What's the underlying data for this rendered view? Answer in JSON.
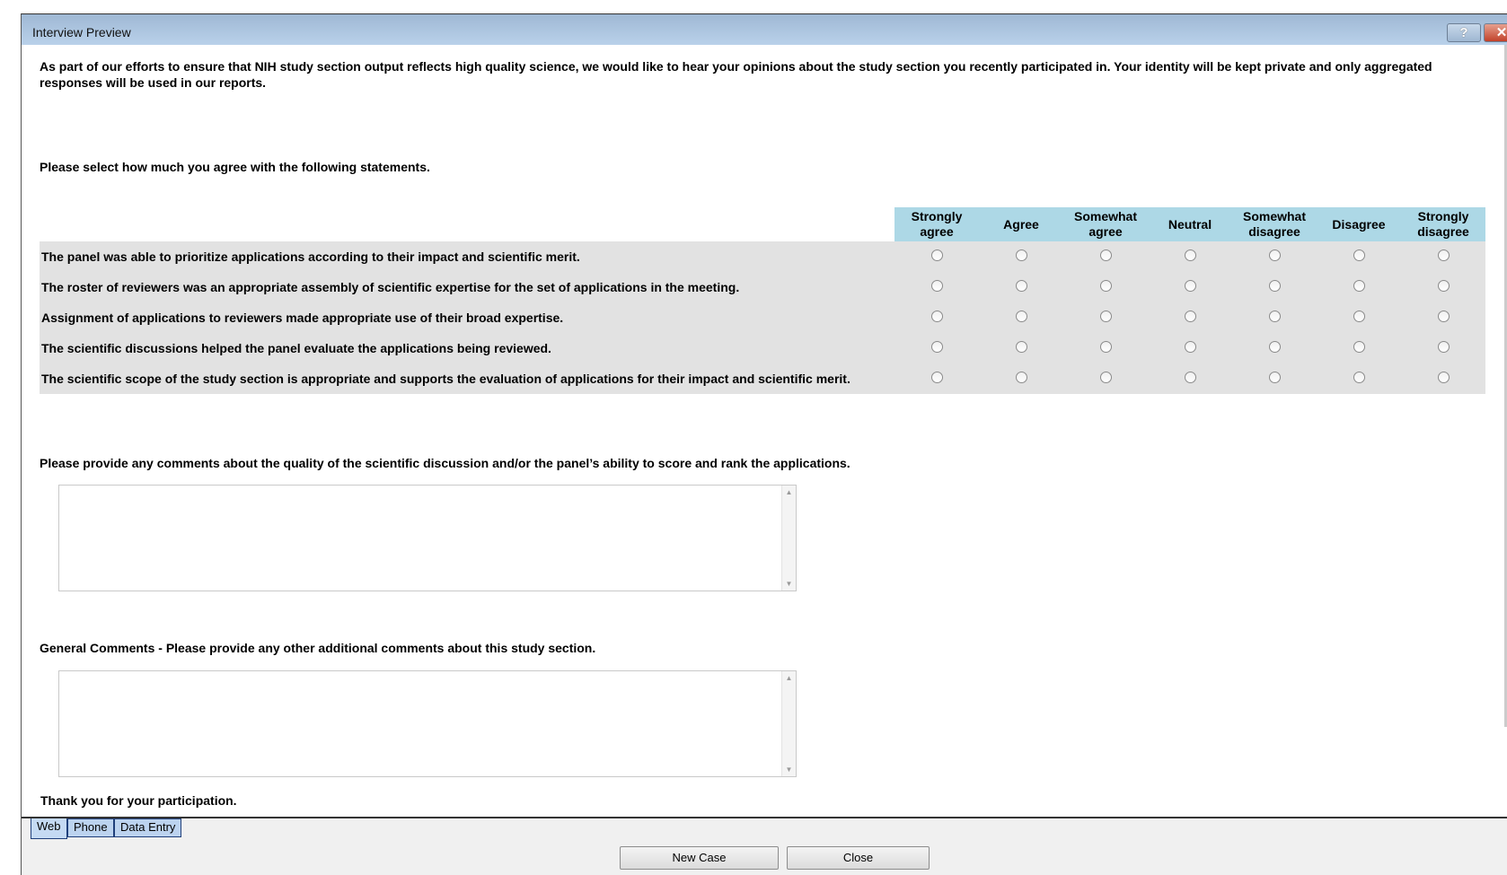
{
  "window": {
    "title": "Interview Preview",
    "help_label": "?",
    "close_label": "✕"
  },
  "intro": "As part of our efforts to ensure that NIH study section output reflects high quality science, we would like to hear your opinions about the study section you recently participated in. Your identity will be kept private and only aggregated responses will be used in our reports.",
  "matrix": {
    "prompt": "Please select how much you agree with the following statements.",
    "columns": [
      "Strongly agree",
      "Agree",
      "Somewhat agree",
      "Neutral",
      "Somewhat disagree",
      "Disagree",
      "Strongly disagree"
    ],
    "rows": [
      "The panel was able to prioritize applications according to their impact and scientific merit.",
      "The roster of reviewers was an appropriate assembly of scientific expertise for the set of applications in the meeting.",
      "Assignment of applications to reviewers made appropriate use of their broad expertise.",
      "The scientific discussions helped the panel evaluate the applications being reviewed.",
      "The scientific scope of the study section is appropriate and supports the evaluation of applications for their impact and scientific merit."
    ],
    "selected": [
      null,
      null,
      null,
      null,
      null
    ]
  },
  "comments": {
    "label": "Please provide any comments about the quality of the scientific discussion and/or the panel’s ability to score and rank the applications.",
    "value": ""
  },
  "general": {
    "label": "General Comments - Please provide any other additional comments about this study section.",
    "value": ""
  },
  "thanks": "Thank you for your participation.",
  "tabs": [
    {
      "label": "Web",
      "active": true
    },
    {
      "label": "Phone"
    },
    {
      "label": "Data Entry"
    }
  ],
  "buttons": {
    "new_case": "New Case",
    "close": "Close"
  },
  "colors": {
    "header": "#add8e6",
    "row": "#e2e2e2"
  }
}
